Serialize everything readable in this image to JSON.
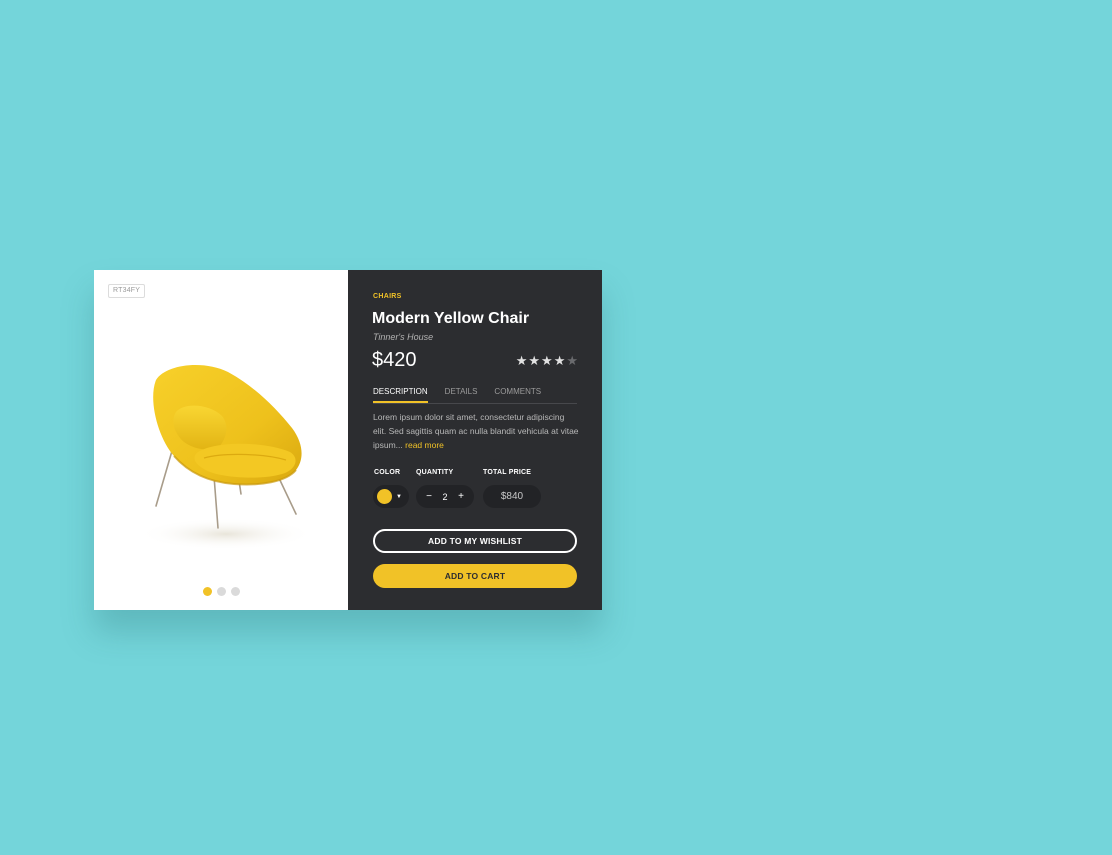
{
  "product": {
    "sku": "RT34FY",
    "category": "CHAIRS",
    "title": "Modern Yellow Chair",
    "brand": "Tinner's House",
    "price": "$420",
    "rating": 4,
    "rating_max": 5
  },
  "tabs": [
    {
      "label": "DESCRIPTION",
      "active": true
    },
    {
      "label": "DETAILS",
      "active": false
    },
    {
      "label": "COMMENTS",
      "active": false
    }
  ],
  "description": {
    "text": "Lorem ipsum dolor sit amet, consectetur adipiscing elit. Sed sagittis quam ac nulla blandit vehicula at vitae ipsum...",
    "read_more": "read more"
  },
  "options": {
    "color_label": "COLOR",
    "color_value": "#f1c227",
    "quantity_label": "QUANTITY",
    "quantity": "2",
    "decrement": "−",
    "increment": "+",
    "total_label": "TOTAL PRICE",
    "total": "$840"
  },
  "buttons": {
    "wishlist": "ADD TO MY WISHLIST",
    "cart": "ADD TO CART"
  },
  "carousel": {
    "slide_count": 3,
    "active_index": 0
  },
  "colors": {
    "background": "#74d5da",
    "accent": "#f1c227",
    "panel": "#2c2d30"
  },
  "icons": {
    "star": "star-icon",
    "caret": "caret-down-icon"
  }
}
